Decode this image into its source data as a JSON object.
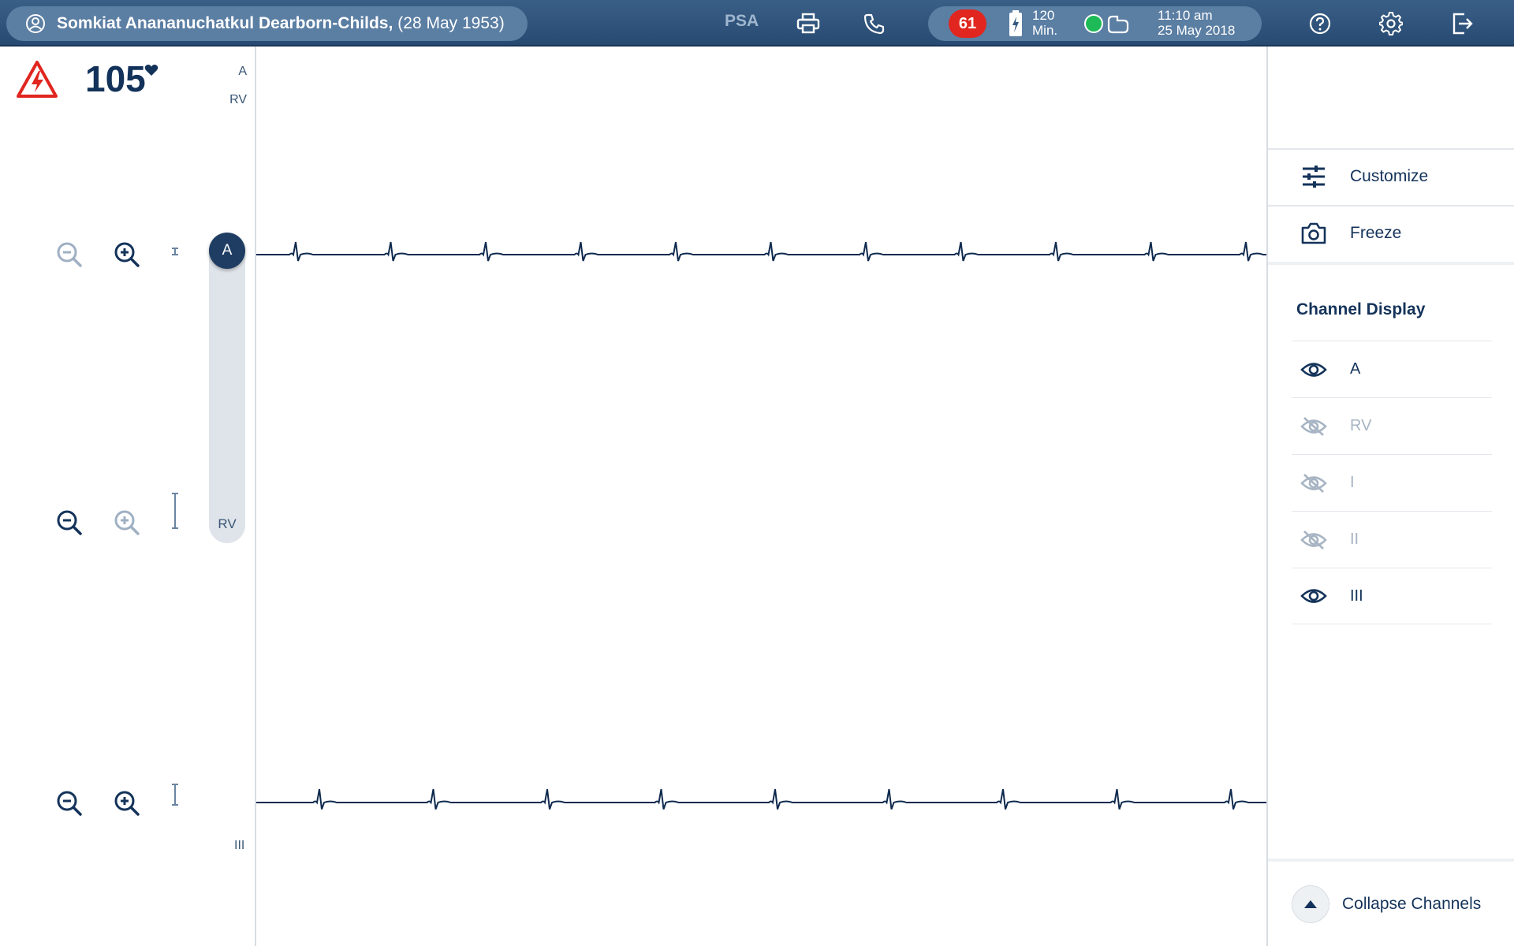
{
  "header": {
    "patient_name": "Somkiat Anananuchatkul Dearborn-Childs,",
    "patient_dob": "(28 May 1953)",
    "mode": "PSA",
    "alarm_count": "61",
    "battery_minutes": "120",
    "battery_unit": "Min.",
    "time": "11:10 am",
    "date": "25 May 2018",
    "colors": {
      "bar": "#2f5480",
      "pill": "#5b7ea3",
      "alarm": "#e0261f",
      "connected": "#1fba58"
    }
  },
  "vitals": {
    "heart_rate": "105",
    "leads": [
      "A",
      "RV"
    ]
  },
  "channels": {
    "slider_top_label": "A",
    "slider_bottom_label": "RV",
    "lead_iii_label": "III"
  },
  "right_panel": {
    "customize_label": "Customize",
    "freeze_label": "Freeze",
    "channel_display_title": "Channel Display",
    "channel_items": [
      {
        "label": "A",
        "visible": true
      },
      {
        "label": "RV",
        "visible": false
      },
      {
        "label": "I",
        "visible": false
      },
      {
        "label": "II",
        "visible": false
      },
      {
        "label": "III",
        "visible": true
      }
    ],
    "collapse_label": "Collapse Channels"
  }
}
